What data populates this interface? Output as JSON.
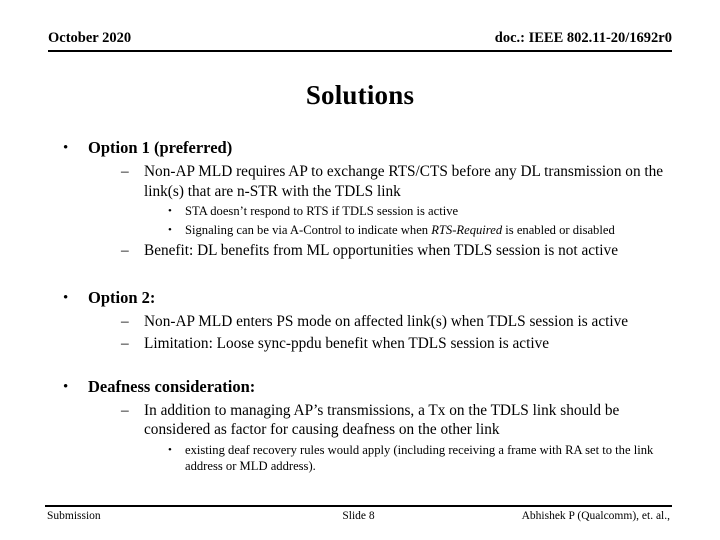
{
  "header": {
    "left": "October 2020",
    "right": "doc.: IEEE 802.11-20/1692r0"
  },
  "title": "Solutions",
  "content": {
    "option1": {
      "heading": "Option 1 (preferred)",
      "sub1": "Non-AP MLD requires AP to exchange RTS/CTS before any DL transmission on the link(s) that are n-STR with the TDLS link",
      "sub1_notes": {
        "note1": "STA doesn’t respond to RTS if TDLS session is active",
        "note2_pre": "Signaling can be via A-Control to indicate when ",
        "note2_italic": "RTS-Required",
        "note2_post": " is enabled or disabled"
      },
      "sub2": "Benefit: DL benefits from ML opportunities when TDLS session is not active"
    },
    "option2": {
      "heading": "Option 2:",
      "sub1": "Non-AP MLD enters PS mode on affected link(s) when TDLS session is active",
      "sub2": "Limitation: Loose sync-ppdu benefit when TDLS session is active"
    },
    "deafness": {
      "heading": "Deafness consideration:",
      "sub1": "In addition to managing AP’s transmissions, a Tx on the TDLS link should be considered as factor for causing deafness on the other link",
      "sub1_note": "existing deaf recovery rules would apply (including receiving a frame with RA set to the link address or MLD address)."
    }
  },
  "markers": {
    "level1": "•",
    "level2": "–",
    "level3": "•"
  },
  "footer": {
    "left": "Submission",
    "center": "Slide 8",
    "right": "Abhishek P (Qualcomm), et. al.,"
  }
}
